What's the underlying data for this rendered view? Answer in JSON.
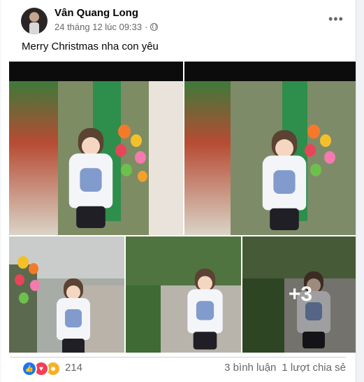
{
  "post": {
    "author": "Vân Quang Long",
    "timestamp": "24 tháng 12 lúc 09:33",
    "separator": "·",
    "privacy_icon": "globe-icon",
    "more_label": "•••",
    "caption": "Merry Christmas nha con yêu"
  },
  "photos": {
    "extra_count_label": "+3"
  },
  "footer": {
    "reaction_icons": [
      "like-icon",
      "love-icon",
      "care-icon"
    ],
    "reaction_count": "214",
    "comments": "3 bình luận",
    "shares": "1 lượt chia sẻ"
  },
  "colors": {
    "accent": "#1877f2",
    "love": "#f33e58",
    "care": "#f7b125",
    "text_secondary": "#65676b"
  }
}
